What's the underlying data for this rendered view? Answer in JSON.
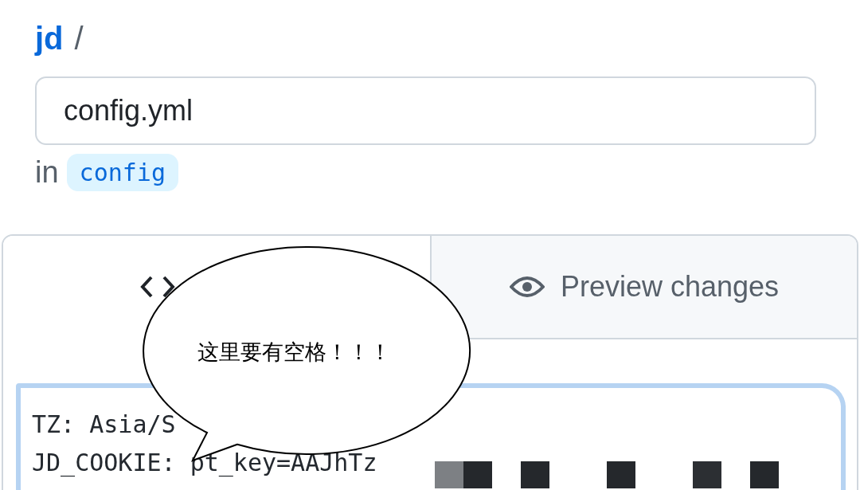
{
  "breadcrumb": {
    "repo": "jd",
    "separator": "/"
  },
  "filename_field": {
    "value": "config.yml"
  },
  "branch": {
    "prefix": "in",
    "name": "config"
  },
  "tabs": [
    {
      "selected": true,
      "kind": "edit"
    },
    {
      "label": "Preview changes",
      "selected": false,
      "kind": "preview"
    }
  ],
  "editor": {
    "lines": [
      "TZ: Asia/S",
      "JD_COOKIE: pt_key=AAJhTz"
    ]
  },
  "callout": {
    "text": "这里要有空格！！！"
  }
}
